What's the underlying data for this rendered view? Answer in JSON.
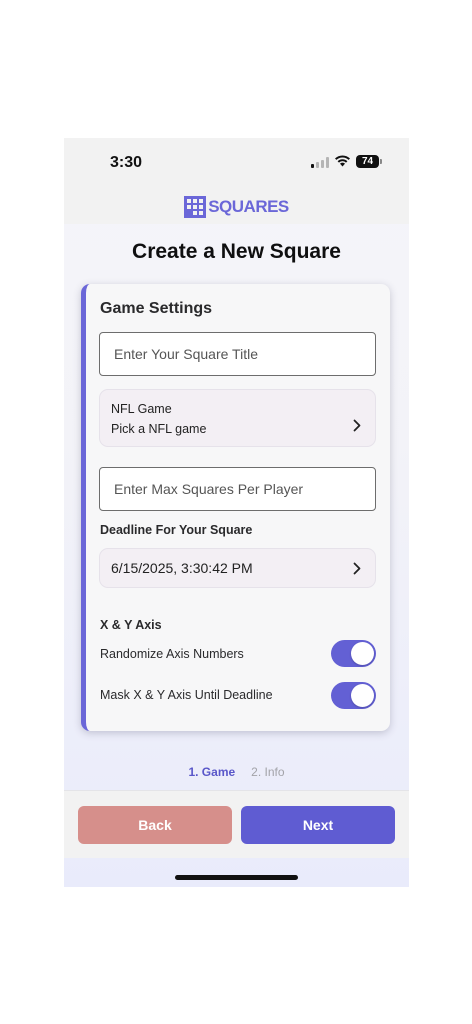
{
  "status_bar": {
    "time": "3:30",
    "battery": "74"
  },
  "brand": {
    "name": "SQUARES"
  },
  "page": {
    "title": "Create a New Square"
  },
  "game_settings": {
    "title": "Game Settings",
    "square_title_placeholder": "Enter Your Square Title",
    "nfl_game": {
      "label": "NFL Game",
      "value": "Pick a NFL game"
    },
    "max_squares_placeholder": "Enter Max Squares Per Player",
    "deadline": {
      "label": "Deadline For Your Square",
      "value": "6/15/2025, 3:30:42 PM"
    },
    "axis": {
      "label": "X & Y Axis",
      "randomize": {
        "label": "Randomize Axis Numbers",
        "on": true
      },
      "mask": {
        "label": "Mask X & Y Axis Until Deadline",
        "on": true
      }
    }
  },
  "steps": {
    "step1": "1. Game",
    "step2": "2. Info"
  },
  "footer": {
    "back": "Back",
    "next": "Next"
  },
  "colors": {
    "accent": "#6360d4",
    "back_button": "#d68f8b",
    "picker_bg": "#f3eff4"
  }
}
